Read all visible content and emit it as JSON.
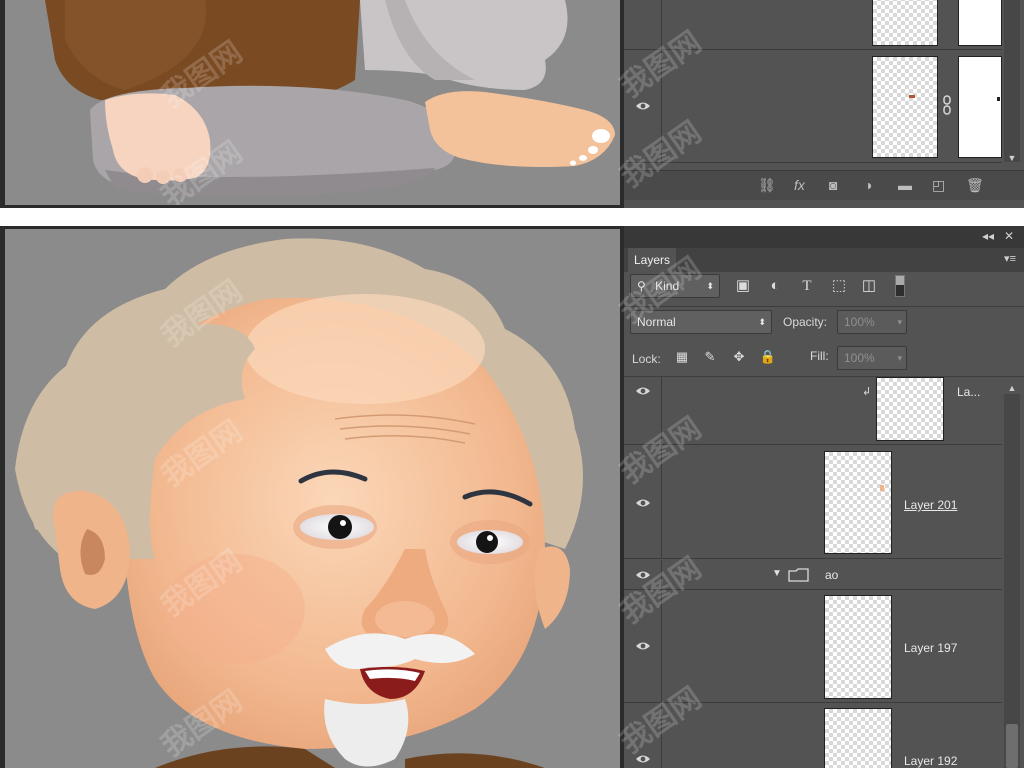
{
  "panel": {
    "tab_label": "Layers",
    "collapse_glyph": "◂◂",
    "close_glyph": "✕",
    "menu_glyph": "▾≡",
    "filter": {
      "search_glyph": "⚲",
      "kind_label": "Kind",
      "icons": [
        "image-filter-icon",
        "adjustment-filter-icon",
        "type-filter-icon",
        "shape-filter-icon",
        "smart-object-filter-icon",
        "filter-toggle-icon"
      ]
    },
    "blend_mode": "Normal",
    "opacity_label": "Opacity:",
    "opacity_value": "100%",
    "lock_label": "Lock:",
    "fill_label": "Fill:",
    "fill_value": "100%"
  },
  "layers": [
    {
      "name": "La...",
      "type": "layer",
      "clipped": true
    },
    {
      "name": "Layer 201",
      "type": "layer",
      "clipped": false
    },
    {
      "name": "ao",
      "type": "group",
      "expanded": true
    },
    {
      "name": "Layer 197",
      "type": "layer",
      "clipped": false
    },
    {
      "name": "Layer 192",
      "type": "layer",
      "clipped": false
    }
  ],
  "footer_icons": [
    "link-layers-icon",
    "fx-icon",
    "add-mask-icon",
    "adjustment-layer-icon",
    "new-group-icon",
    "new-layer-icon",
    "delete-layer-icon"
  ],
  "footer_glyphs": {
    "fx": "fx"
  },
  "watermark_text": "我图网",
  "colors": {
    "canvas_bg": "#8b8b8b",
    "panel_bg": "#535353",
    "skin": "#f3c29b",
    "hair": "#cfbca4",
    "robe": "#7a4a22"
  }
}
